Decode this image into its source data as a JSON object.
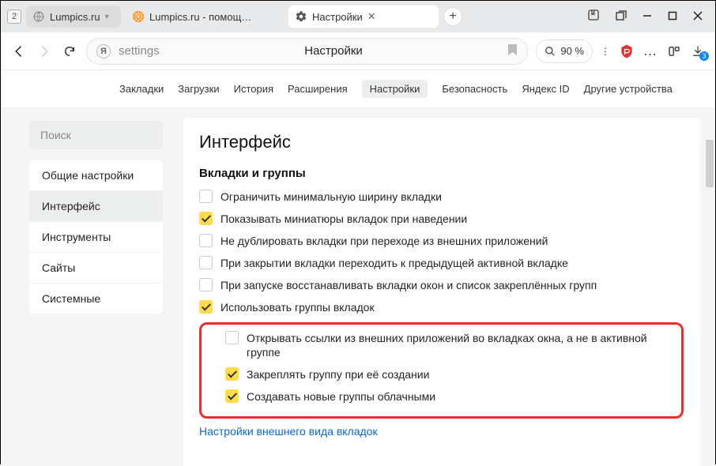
{
  "titlebar": {
    "tab_count": "2",
    "tab1_label": "Lumpics.ru",
    "tab2_label": "Lumpics.ru - помощь с ко",
    "tab3_label": "Настройки"
  },
  "toolbar": {
    "y_letter": "Я",
    "url": "settings",
    "title": "Настройки",
    "zoom": "90 %",
    "dl_count": "3"
  },
  "pagenav": {
    "items": [
      "Закладки",
      "Загрузки",
      "История",
      "Расширения",
      "Настройки",
      "Безопасность",
      "Яндекс ID",
      "Другие устройства"
    ]
  },
  "sidebar": {
    "search_placeholder": "Поиск",
    "items": [
      "Общие настройки",
      "Интерфейс",
      "Инструменты",
      "Сайты",
      "Системные"
    ]
  },
  "main": {
    "h1": "Интерфейс",
    "h2": "Вкладки и группы",
    "opts": [
      {
        "label": "Ограничить минимальную ширину вкладки",
        "checked": false
      },
      {
        "label": "Показывать миниатюры вкладок при наведении",
        "checked": true
      },
      {
        "label": "Не дублировать вкладки при переходе из внешних приложений",
        "checked": false
      },
      {
        "label": "При закрытии вкладки переходить к предыдущей активной вкладке",
        "checked": false
      },
      {
        "label": "При запуске восстанавливать вкладки окон и список закреплённых групп",
        "checked": false
      },
      {
        "label": "Использовать группы вкладок",
        "checked": true
      }
    ],
    "subopts": [
      {
        "label": "Открывать ссылки из внешних приложений во вкладках окна, а не в активной группе",
        "checked": false
      },
      {
        "label": "Закреплять группу при её создании",
        "checked": true
      },
      {
        "label": "Создавать новые группы облачными",
        "checked": true
      }
    ],
    "link": "Настройки внешнего вида вкладок"
  }
}
